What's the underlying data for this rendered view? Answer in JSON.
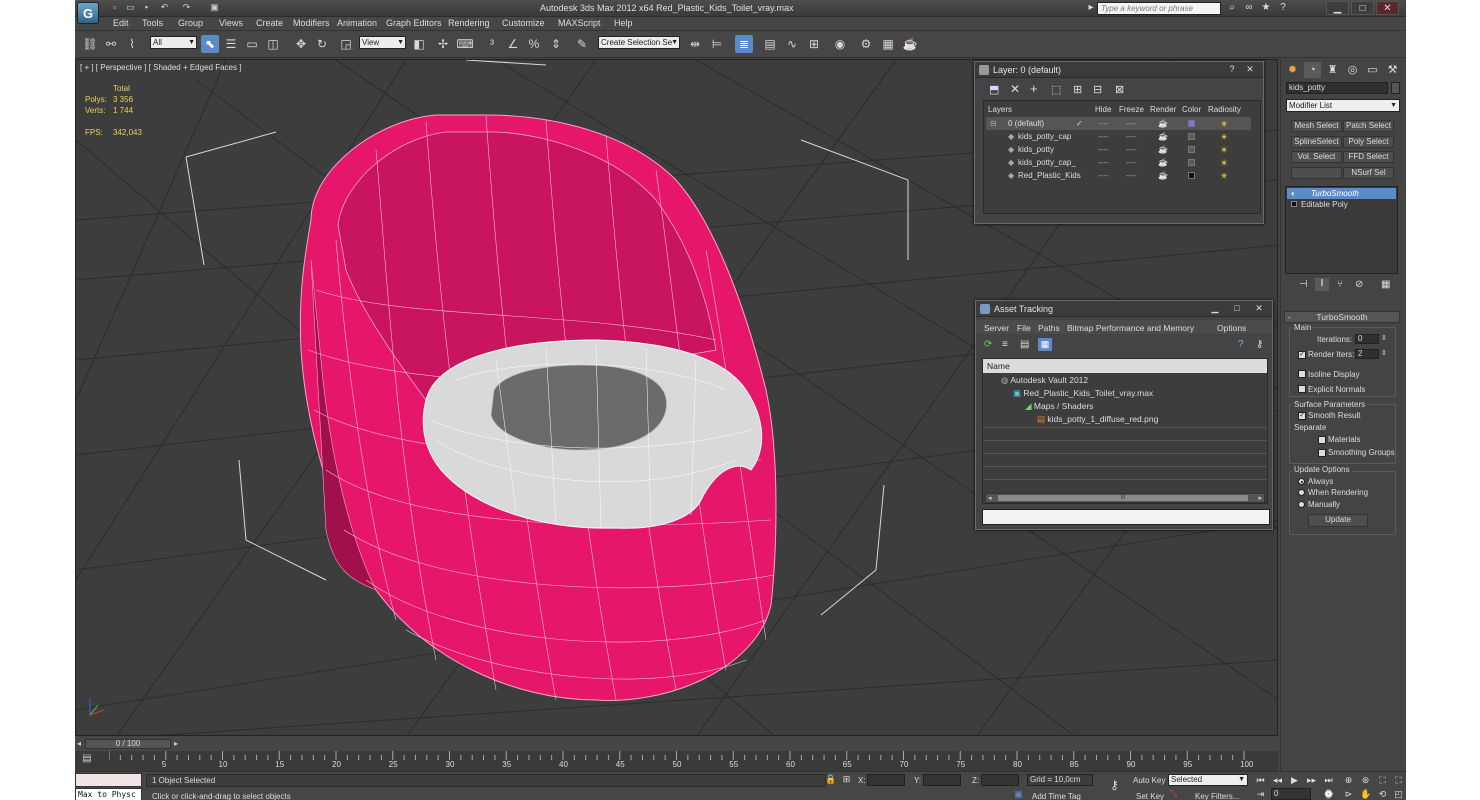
{
  "window": {
    "title": "Autodesk 3ds Max  2012 x64      Red_Plastic_Kids_Toilet_vray.max",
    "search_placeholder": "Type a keyword or phrase"
  },
  "menu": [
    "Edit",
    "Tools",
    "Group",
    "Views",
    "Create",
    "Modifiers",
    "Animation",
    "Graph Editors",
    "Rendering",
    "Customize",
    "MAXScript",
    "Help"
  ],
  "toolbar": {
    "selection_filter": "All",
    "coord_system": "View",
    "named_selection": "Create Selection Se"
  },
  "viewport": {
    "label": "[ + ] [ Perspective ] [ Shaded + Edged Faces ]",
    "stats": {
      "total_label": "Total",
      "polys_label": "Polys:",
      "polys_value": "3 356",
      "verts_label": "Verts:",
      "verts_value": "1 744",
      "fps_label": "FPS:",
      "fps_value": "342,043"
    }
  },
  "layer_panel": {
    "title": "Layer: 0 (default)",
    "columns": [
      "Layers",
      "Hide",
      "Freeze",
      "Render",
      "Color",
      "Radiosity"
    ],
    "rows": [
      {
        "name": "0 (default)",
        "color": "#8a6cf0",
        "checked": "✓"
      },
      {
        "name": "kids_potty_cap",
        "color": "#5a5a5a",
        "checked": ""
      },
      {
        "name": "kids_potty",
        "color": "#5a5a5a",
        "checked": ""
      },
      {
        "name": "kids_potty_cap_",
        "color": "#5a5a5a",
        "checked": ""
      },
      {
        "name": "Red_Plastic_Kids",
        "color": "#111111",
        "checked": ""
      }
    ]
  },
  "asset_panel": {
    "title": "Asset Tracking",
    "menu": [
      "Server",
      "File",
      "Paths",
      "Bitmap Performance and Memory",
      "Options"
    ],
    "column": "Name",
    "rows": [
      {
        "label": "Autodesk Vault 2012"
      },
      {
        "label": "Red_Plastic_Kids_Toilet_vray.max"
      },
      {
        "label": "Maps / Shaders"
      },
      {
        "label": "kids_potty_1_diffuse_red.png"
      }
    ],
    "scroll_grip": "III"
  },
  "command_panel": {
    "object_name": "kids_potty",
    "modifier_list": "Modifier List",
    "buttons": [
      "Mesh Select",
      "Patch Select",
      "SplineSelect",
      "Poly Select",
      "Vol. Select",
      "FFD Select",
      "NSurf Sel"
    ],
    "stack": [
      "TurboSmooth",
      "Editable Poly"
    ],
    "rollout_title": "TurboSmooth",
    "main_label": "Main",
    "iterations_label": "Iterations:",
    "iterations_value": "0",
    "render_iters_label": "Render Iters:",
    "render_iters_value": "2",
    "isoline_label": "Isoline Display",
    "explicit_normals_label": "Explicit Normals",
    "surface_params_label": "Surface Parameters",
    "smooth_result_label": "Smooth Result",
    "separate_label": "Separate",
    "materials_label": "Materials",
    "smoothing_groups_label": "Smoothing Groups",
    "update_options_label": "Update Options",
    "always_label": "Always",
    "when_rendering_label": "When Rendering",
    "manually_label": "Manually",
    "update_button": "Update"
  },
  "timeline": {
    "frame_counter": "0 / 100",
    "ticks": [
      "5",
      "10",
      "15",
      "20",
      "25",
      "30",
      "35",
      "40",
      "45",
      "50",
      "55",
      "60",
      "65",
      "70",
      "75",
      "80",
      "85",
      "90",
      "95",
      "100"
    ]
  },
  "status": {
    "maxscript": "Max to Physc",
    "selected_count": "1 Object Selected",
    "prompt": "Click or click-and-drag to select objects",
    "x_label": "X:",
    "y_label": "Y:",
    "z_label": "Z:",
    "grid": "Grid = 10,0cm",
    "add_time_tag": "Add Time Tag",
    "auto_key": "Auto Key",
    "set_key": "Set Key",
    "key_mode": "Selected",
    "key_filters": "Key Filters...",
    "frame": "0"
  }
}
